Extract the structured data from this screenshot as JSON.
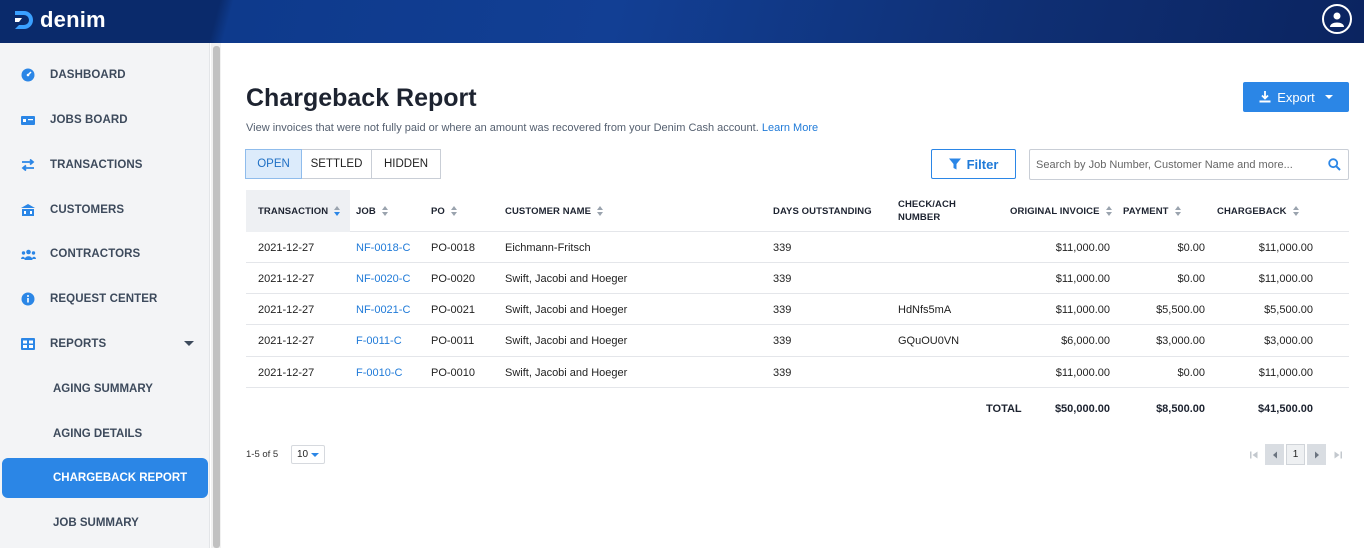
{
  "app": {
    "brand": "denim"
  },
  "sidebar": {
    "items": [
      {
        "label": "DASHBOARD",
        "icon": "dashboard-icon"
      },
      {
        "label": "JOBS BOARD",
        "icon": "jobs-board-icon"
      },
      {
        "label": "TRANSACTIONS",
        "icon": "transactions-icon"
      },
      {
        "label": "CUSTOMERS",
        "icon": "customers-icon"
      },
      {
        "label": "CONTRACTORS",
        "icon": "contractors-icon"
      },
      {
        "label": "REQUEST CENTER",
        "icon": "info-icon"
      },
      {
        "label": "REPORTS",
        "icon": "reports-icon"
      }
    ],
    "subitems": [
      {
        "label": "AGING SUMMARY"
      },
      {
        "label": "AGING DETAILS"
      },
      {
        "label": "CHARGEBACK REPORT",
        "active": true
      },
      {
        "label": "JOB SUMMARY"
      }
    ]
  },
  "page": {
    "title": "Chargeback Report",
    "subtitle": "View invoices that were not fully paid or where an amount was recovered from your Denim Cash account.",
    "learn_more": "Learn More",
    "export_label": "Export",
    "filter_label": "Filter",
    "search_placeholder": "Search by Job Number, Customer Name and more...",
    "tabs": [
      {
        "label": "OPEN",
        "selected": true
      },
      {
        "label": "SETTLED"
      },
      {
        "label": "HIDDEN"
      }
    ]
  },
  "table": {
    "headers": {
      "transaction": "TRANSACTION",
      "job": "JOB",
      "po": "PO",
      "customer": "CUSTOMER NAME",
      "days": "DAYS OUTSTANDING",
      "check_line1": "CHECK/ACH",
      "check_line2": "NUMBER",
      "invoice": "ORIGINAL INVOICE",
      "payment": "PAYMENT",
      "chargeback": "CHARGEBACK"
    },
    "rows": [
      {
        "transaction": "2021-12-27",
        "job": "NF-0018-C",
        "po": "PO-0018",
        "customer": "Eichmann-Fritsch",
        "days": "339",
        "check": "",
        "invoice": "$11,000.00",
        "payment": "$0.00",
        "chargeback": "$11,000.00"
      },
      {
        "transaction": "2021-12-27",
        "job": "NF-0020-C",
        "po": "PO-0020",
        "customer": "Swift, Jacobi and Hoeger",
        "days": "339",
        "check": "",
        "invoice": "$11,000.00",
        "payment": "$0.00",
        "chargeback": "$11,000.00"
      },
      {
        "transaction": "2021-12-27",
        "job": "NF-0021-C",
        "po": "PO-0021",
        "customer": "Swift, Jacobi and Hoeger",
        "days": "339",
        "check": "HdNfs5mA",
        "invoice": "$11,000.00",
        "payment": "$5,500.00",
        "chargeback": "$5,500.00"
      },
      {
        "transaction": "2021-12-27",
        "job": "F-0011-C",
        "po": "PO-0011",
        "customer": "Swift, Jacobi and Hoeger",
        "days": "339",
        "check": "GQuOU0VN",
        "invoice": "$6,000.00",
        "payment": "$3,000.00",
        "chargeback": "$3,000.00"
      },
      {
        "transaction": "2021-12-27",
        "job": "F-0010-C",
        "po": "PO-0010",
        "customer": "Swift, Jacobi and Hoeger",
        "days": "339",
        "check": "",
        "invoice": "$11,000.00",
        "payment": "$0.00",
        "chargeback": "$11,000.00"
      }
    ],
    "totals": {
      "label": "TOTAL",
      "invoice": "$50,000.00",
      "payment": "$8,500.00",
      "chargeback": "$41,500.00"
    }
  },
  "pagination": {
    "range": "1-5 of 5",
    "per_page": "10",
    "current_page": "1"
  },
  "colors": {
    "accent": "#2b86e6",
    "nav_bg": "#0e3a8c",
    "sidebar_bg": "#f3f4f6"
  }
}
